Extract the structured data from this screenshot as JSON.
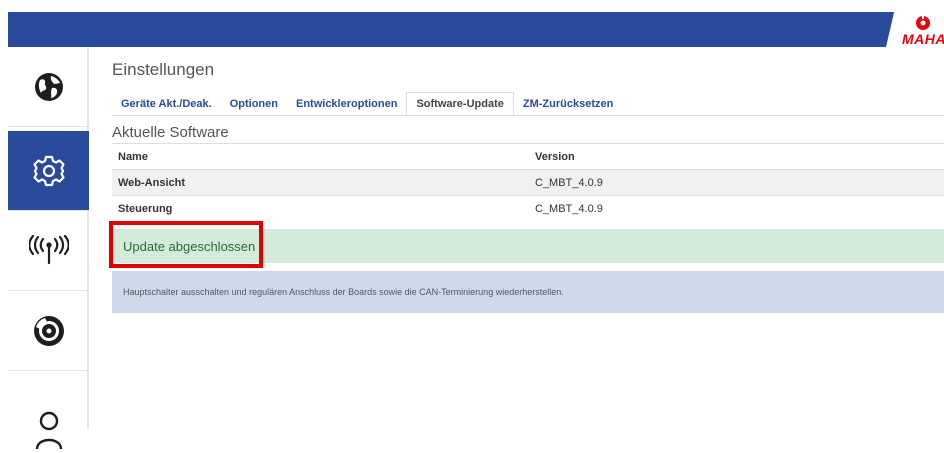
{
  "brand": {
    "logo_text": "MAHA",
    "primary_color": "#2a4a9c",
    "accent_color": "#e30613"
  },
  "sidebar": {
    "items": [
      {
        "icon": "globe-icon",
        "active": false
      },
      {
        "icon": "gear-icon",
        "active": true
      },
      {
        "icon": "antenna-icon",
        "active": false
      },
      {
        "icon": "brake-disc-icon",
        "active": false
      },
      {
        "icon": "user-icon",
        "active": false
      }
    ]
  },
  "page": {
    "title": "Einstellungen"
  },
  "tabs": [
    {
      "label": "Geräte Akt./Deak.",
      "active": false
    },
    {
      "label": "Optionen",
      "active": false
    },
    {
      "label": "Entwickleroptionen",
      "active": false
    },
    {
      "label": "Software-Update",
      "active": true
    },
    {
      "label": "ZM-Zurücksetzen",
      "active": false
    }
  ],
  "software": {
    "title": "Aktuelle Software",
    "headers": {
      "name": "Name",
      "version": "Version"
    },
    "rows": [
      {
        "name": "Web-Ansicht",
        "version": "C_MBT_4.0.9"
      },
      {
        "name": "Steuerung",
        "version": "C_MBT_4.0.9"
      }
    ]
  },
  "alerts": {
    "success": "Update abgeschlossen",
    "info": "Hauptschalter ausschalten und regulären Anschluss der Boards sowie die CAN-Terminierung wiederherstellen."
  }
}
